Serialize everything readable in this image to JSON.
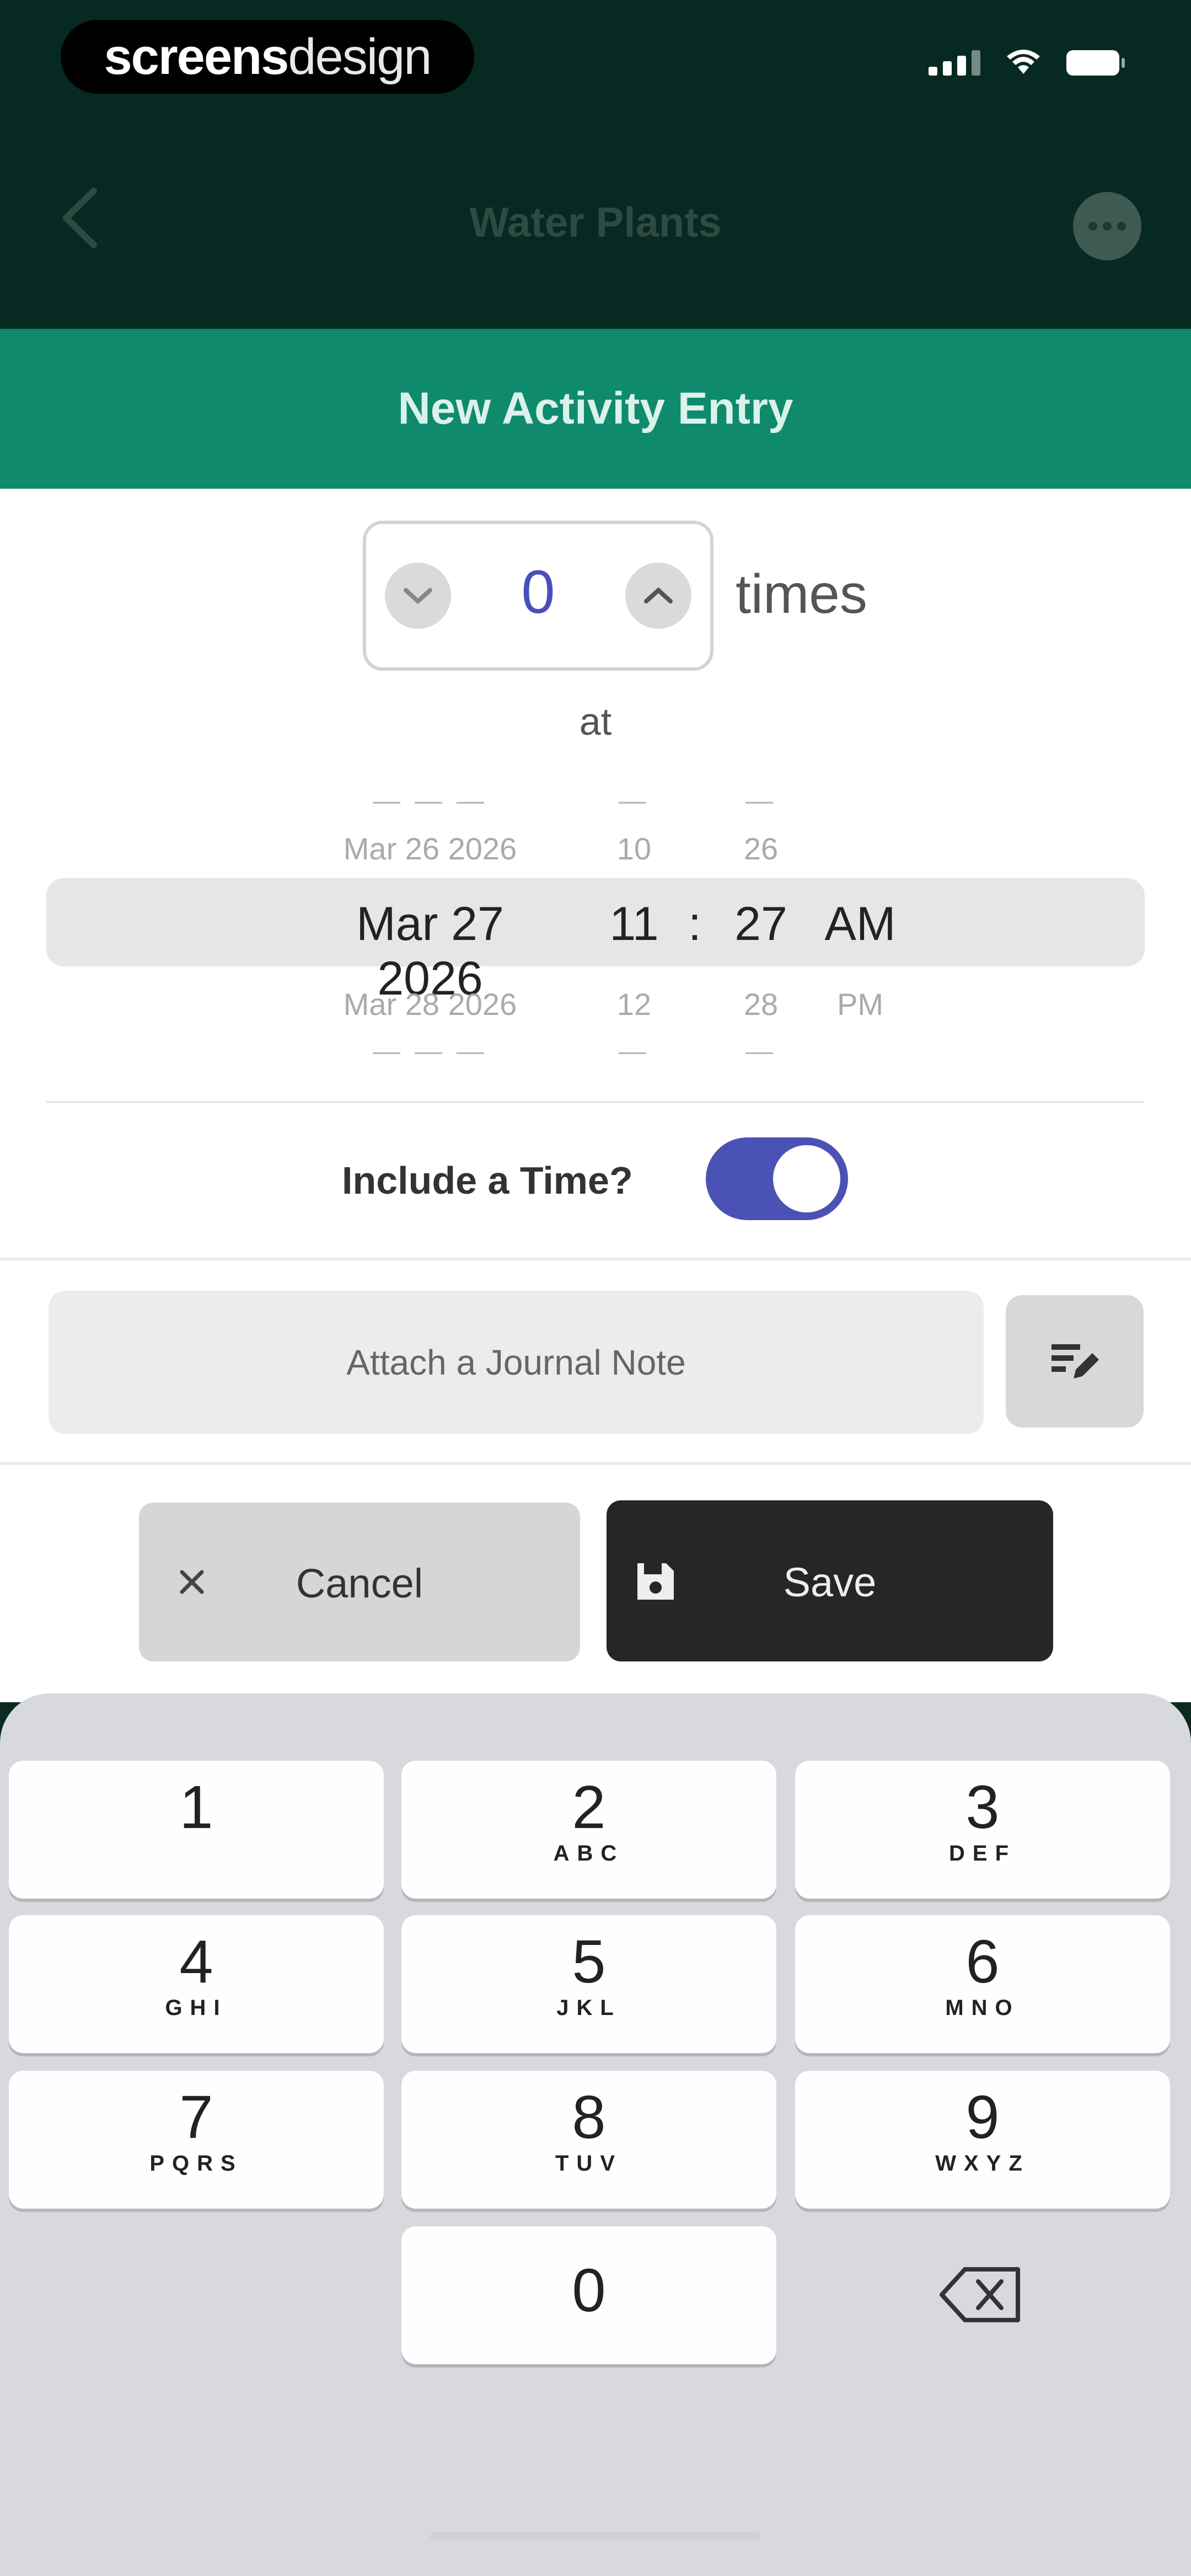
{
  "brand": {
    "part1": "screens",
    "part2": "design"
  },
  "nav": {
    "title": "Water Plants"
  },
  "sheet": {
    "title": "New Activity Entry"
  },
  "counter": {
    "value": "0",
    "unit_label": "times"
  },
  "at_label": "at",
  "date_picker": {
    "rows": [
      {
        "date": "— — —",
        "hour": "—",
        "minute": "—",
        "period": ""
      },
      {
        "date": "Mar 26 2026",
        "hour": "10",
        "minute": "26",
        "period": ""
      },
      {
        "date": "Mar 27 2026",
        "hour": "11",
        "minute": "27",
        "period": "AM"
      },
      {
        "date": "Mar 28 2026",
        "hour": "12",
        "minute": "28",
        "period": "PM"
      },
      {
        "date": "— — —",
        "hour": "—",
        "minute": "—",
        "period": ""
      }
    ],
    "separator": ":"
  },
  "include_time": {
    "label": "Include a Time?",
    "enabled": true
  },
  "journal": {
    "label": "Attach a Journal Note"
  },
  "actions": {
    "cancel_label": "Cancel",
    "save_label": "Save"
  },
  "keypad": {
    "keys": [
      {
        "num": "1",
        "letters": ""
      },
      {
        "num": "2",
        "letters": "ABC"
      },
      {
        "num": "3",
        "letters": "DEF"
      },
      {
        "num": "4",
        "letters": "GHI"
      },
      {
        "num": "5",
        "letters": "JKL"
      },
      {
        "num": "6",
        "letters": "MNO"
      },
      {
        "num": "7",
        "letters": "PQRS"
      },
      {
        "num": "8",
        "letters": "TUV"
      },
      {
        "num": "9",
        "letters": "WXYZ"
      },
      {
        "num": "0",
        "letters": ""
      }
    ]
  },
  "colors": {
    "header_bg": "#062a21",
    "sheet_header": "#0f8a6c",
    "toggle_on": "#4b52b5",
    "save_bg": "#262626"
  }
}
